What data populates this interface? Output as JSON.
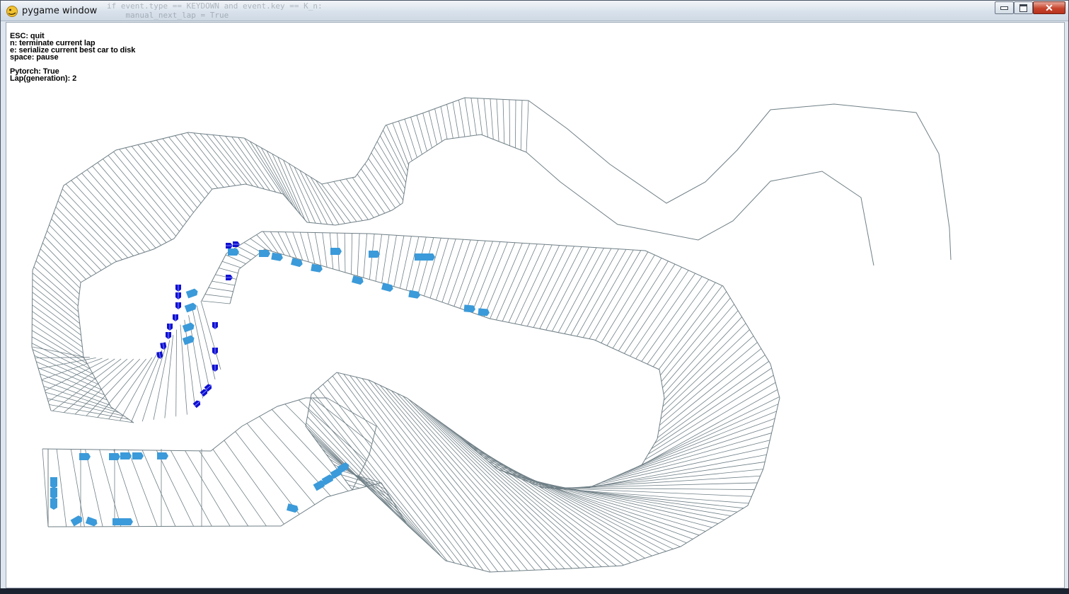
{
  "window": {
    "title": "pygame window",
    "icon": "pygame-snake-icon",
    "controls": {
      "minimize_icon": "minimize-icon",
      "maximize_icon": "maximize-icon",
      "close_icon": "close-icon"
    },
    "background_text": [
      "if event.type == KEYDOWN and event.key == K_n:",
      "    manual_next_lap = True"
    ]
  },
  "hud": {
    "help": [
      "ESC: quit",
      "n: terminate current lap",
      "e: serialize current best car to disk",
      "space: pause"
    ],
    "status": [
      "Pytorch: True",
      "Lap(generation): 2"
    ]
  },
  "colors": {
    "track_line": "#6f7f86",
    "car_light": "#3b9ad9",
    "car_dark": "#1010d0",
    "background": "#ffffff"
  }
}
